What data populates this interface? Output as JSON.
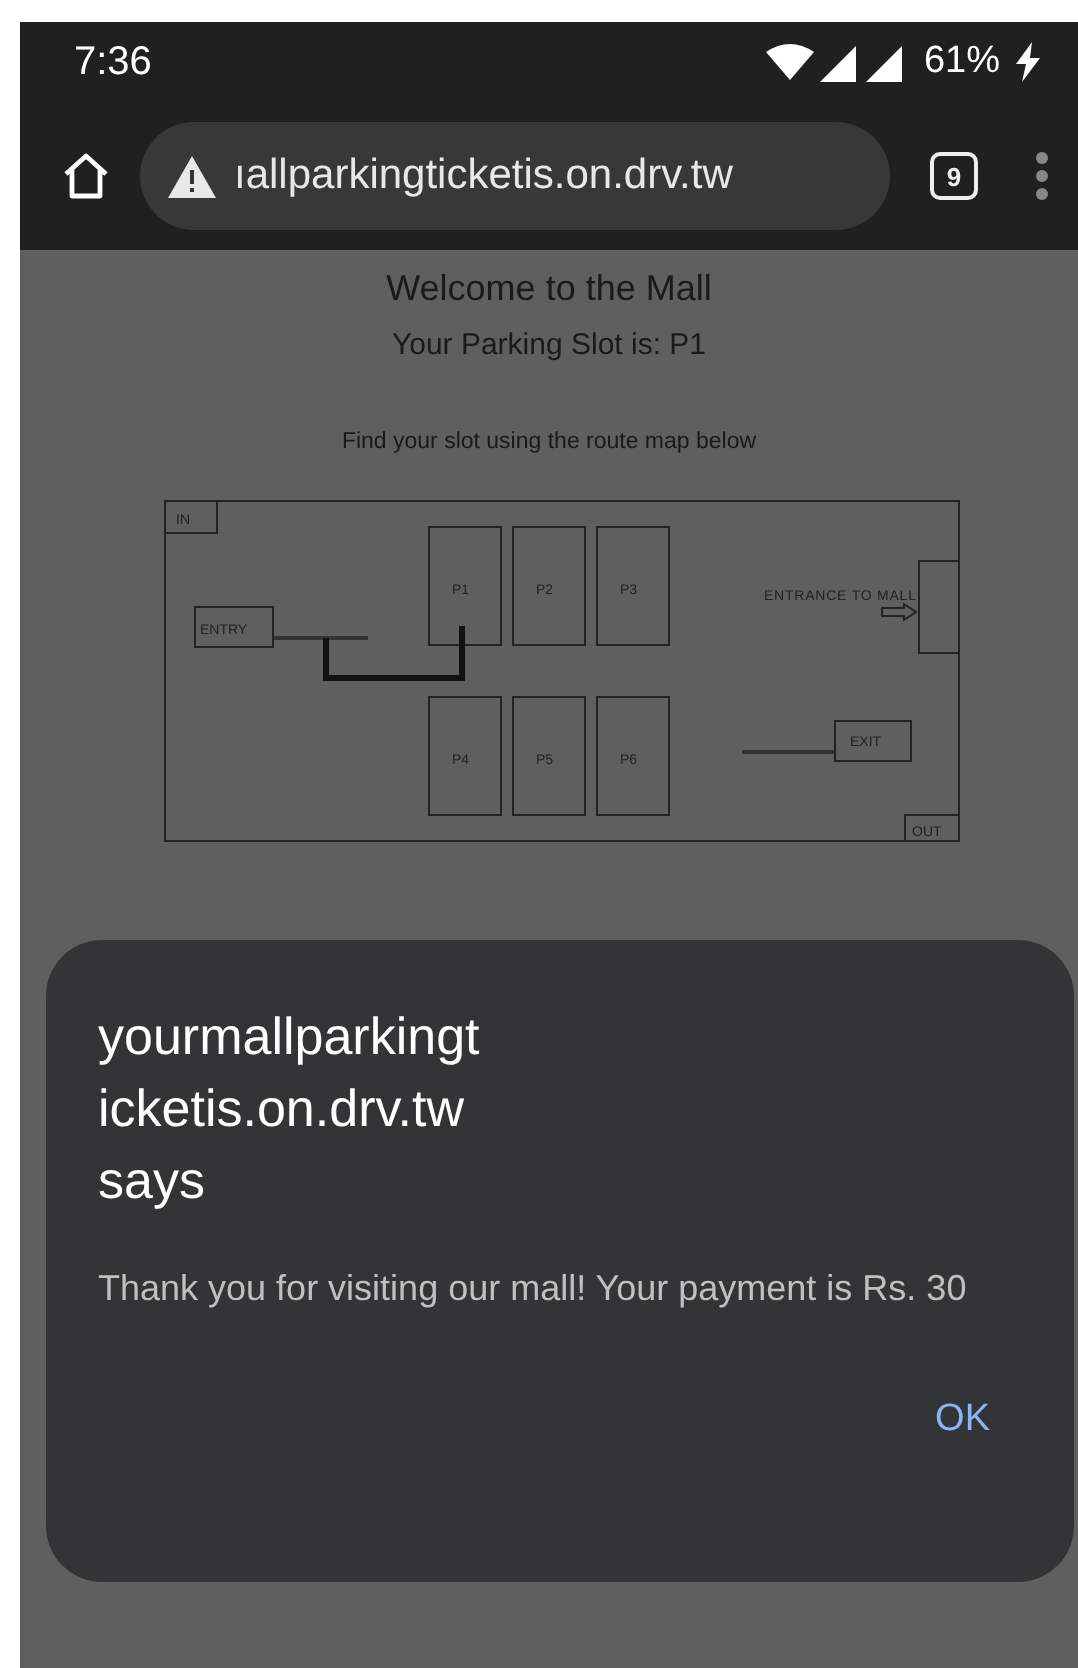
{
  "status_bar": {
    "time": "7:36",
    "battery": "61%"
  },
  "browser": {
    "url": "ıallparkingticketis.on.drv.tw",
    "tab_count": "9"
  },
  "page": {
    "heading": "Welcome to the Mall",
    "slot_line": "Your Parking Slot is: P1",
    "instruction": "Find your slot using the route map below",
    "map": {
      "in_label": "IN",
      "entry_label": "ENTRY",
      "entrance_label": "ENTRANCE TO MALL",
      "exit_label": "EXIT",
      "out_label": "OUT",
      "slots": [
        {
          "label": "P1"
        },
        {
          "label": "P2"
        },
        {
          "label": "P3"
        },
        {
          "label": "P4"
        },
        {
          "label": "P5"
        },
        {
          "label": "P6"
        }
      ]
    }
  },
  "dialog": {
    "title": "yourmallparkingt\nicketis.on.drv.tw\nsays",
    "message": "Thank you for visiting our mall! Your payment is Rs. 30",
    "button": "OK"
  }
}
